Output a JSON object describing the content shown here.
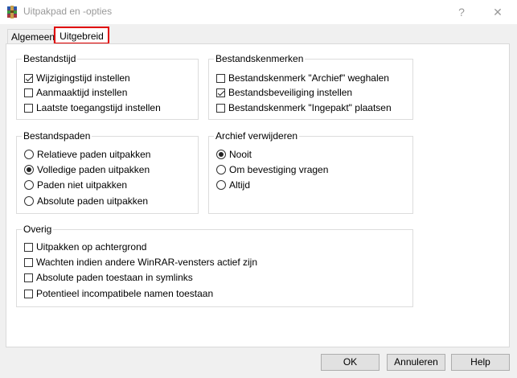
{
  "window": {
    "title": "Uitpakpad en -opties",
    "help_glyph": "?",
    "close_glyph": "✕"
  },
  "tabs": [
    {
      "label": "Algemeen",
      "active": false
    },
    {
      "label": "Uitgebreid",
      "active": true
    }
  ],
  "groups": {
    "file_time": {
      "title": "Bestandstijd",
      "options": [
        {
          "label": "Wijzigingstijd instellen",
          "checked": true
        },
        {
          "label": "Aanmaaktijd instellen",
          "checked": false
        },
        {
          "label": "Laatste toegangstijd instellen",
          "checked": false
        }
      ]
    },
    "file_attributes": {
      "title": "Bestandskenmerken",
      "options": [
        {
          "label": "Bestandskenmerk \"Archief\" weghalen",
          "checked": false
        },
        {
          "label": "Bestandsbeveiliging instellen",
          "checked": true
        },
        {
          "label": "Bestandskenmerk \"Ingepakt\" plaatsen",
          "checked": false
        }
      ]
    },
    "file_paths": {
      "title": "Bestandspaden",
      "options": [
        {
          "label": "Relatieve paden uitpakken",
          "selected": false
        },
        {
          "label": "Volledige paden uitpakken",
          "selected": true
        },
        {
          "label": "Paden niet uitpakken",
          "selected": false
        },
        {
          "label": "Absolute paden uitpakken",
          "selected": false
        }
      ]
    },
    "delete_archive": {
      "title": "Archief verwijderen",
      "options": [
        {
          "label": "Nooit",
          "selected": true
        },
        {
          "label": "Om bevestiging vragen",
          "selected": false
        },
        {
          "label": "Altijd",
          "selected": false
        }
      ]
    },
    "misc": {
      "title": "Overig",
      "options": [
        {
          "label": "Uitpakken op achtergrond",
          "checked": false
        },
        {
          "label": "Wachten indien andere WinRAR-vensters actief zijn",
          "checked": false
        },
        {
          "label": "Absolute paden toestaan in symlinks",
          "checked": false
        },
        {
          "label": "Potentieel incompatibele namen toestaan",
          "checked": false
        }
      ]
    }
  },
  "buttons": {
    "ok": "OK",
    "cancel": "Annuleren",
    "help": "Help"
  }
}
